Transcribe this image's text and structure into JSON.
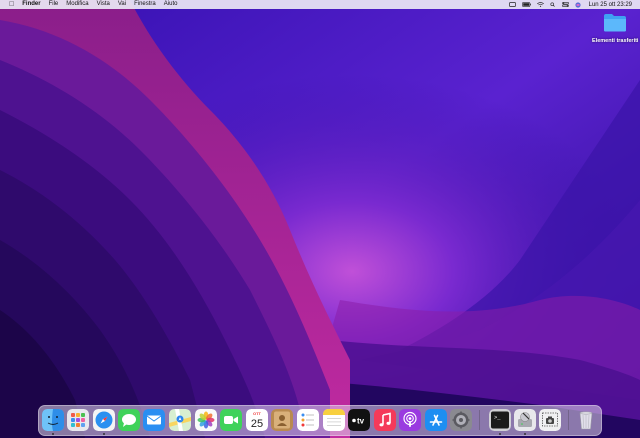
{
  "menubar": {
    "apple_icon": "apple-icon",
    "app_name": "Finder",
    "menus": [
      "File",
      "Modifica",
      "Vista",
      "Vai",
      "Finestra",
      "Aiuto"
    ],
    "status_icons": [
      "display-mirror-icon",
      "battery-icon",
      "wifi-icon",
      "search-icon",
      "control-center-icon",
      "siri-icon"
    ],
    "clock": "Lun 25 ott  23:29"
  },
  "desktop": {
    "folder_label": "Elementi trasferiti"
  },
  "dock": {
    "apps": [
      {
        "name": "finder-icon",
        "running": true
      },
      {
        "name": "launchpad-icon",
        "running": false
      },
      {
        "name": "safari-icon",
        "running": true
      },
      {
        "name": "messages-icon",
        "running": false
      },
      {
        "name": "mail-icon",
        "running": false
      },
      {
        "name": "maps-icon",
        "running": false
      },
      {
        "name": "photos-icon",
        "running": false
      },
      {
        "name": "facetime-icon",
        "running": false
      },
      {
        "name": "calendar-icon",
        "running": false
      },
      {
        "name": "contacts-icon",
        "running": false
      },
      {
        "name": "reminders-icon",
        "running": false
      },
      {
        "name": "notes-icon",
        "running": false
      },
      {
        "name": "apple-tv-icon",
        "running": false
      },
      {
        "name": "music-icon",
        "running": false
      },
      {
        "name": "podcasts-icon",
        "running": false
      },
      {
        "name": "app-store-icon",
        "running": false
      },
      {
        "name": "system-preferences-icon",
        "running": false
      },
      {
        "name": "terminal-icon",
        "running": true
      },
      {
        "name": "disk-utility-icon",
        "running": true
      },
      {
        "name": "screenshot-icon",
        "running": false
      },
      {
        "name": "trash-icon",
        "running": false
      }
    ],
    "calendar": {
      "month": "OTT",
      "day": "25"
    },
    "tv_label": "tv",
    "terminal_prompt": ">_"
  }
}
